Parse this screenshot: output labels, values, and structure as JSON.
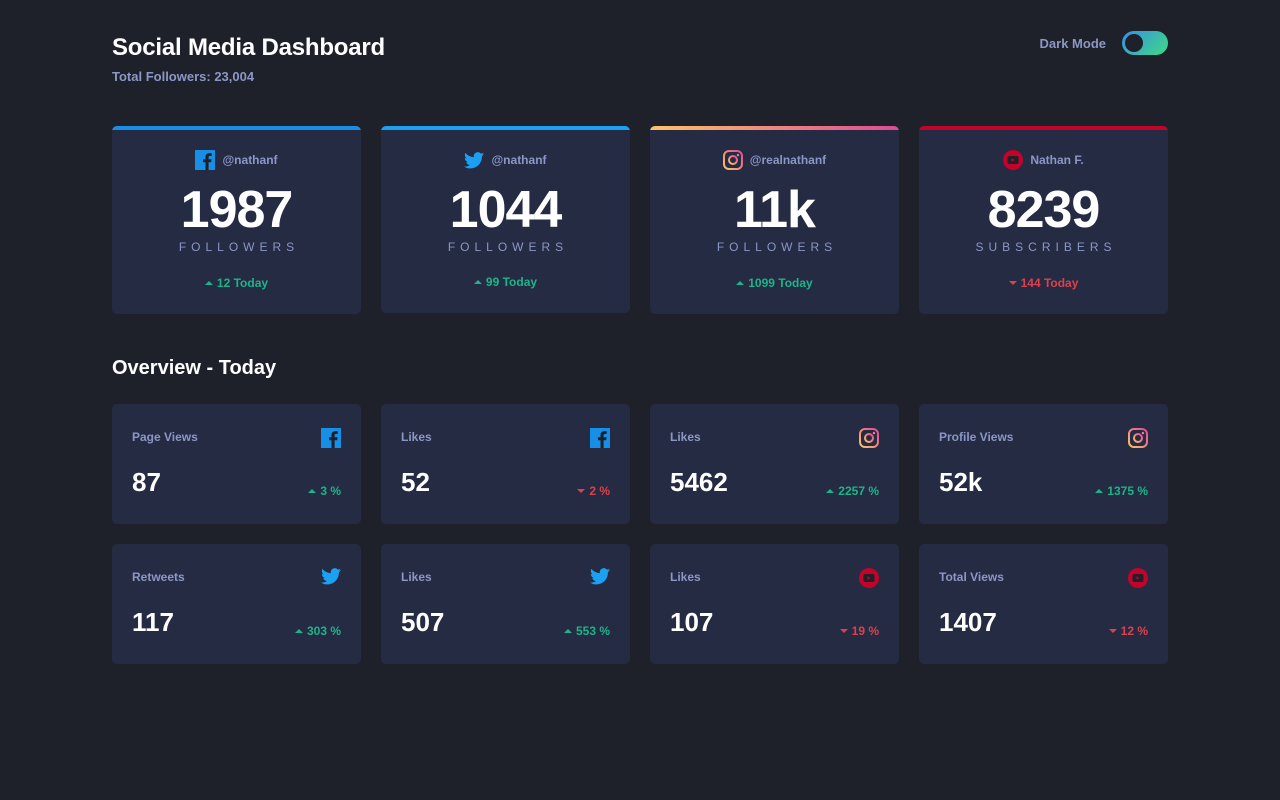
{
  "header": {
    "title": "Social Media Dashboard",
    "total_followers": "Total Followers: 23,004"
  },
  "toggle": {
    "label": "Dark Mode",
    "on": true
  },
  "colors": {
    "background": "#1e202a",
    "card": "#252b43",
    "muted_text": "#8b97c6",
    "up": "#1db489",
    "down": "#dc414c",
    "facebook": "#178fe6",
    "twitter": "#1ca0f2",
    "youtube": "#c4032a",
    "instagram_gradient": [
      "#fdc468",
      "#df4996"
    ]
  },
  "followers": [
    {
      "platform": "facebook",
      "icon": "facebook-icon",
      "handle": "@nathanf",
      "count": "1987",
      "unit": "FOLLOWERS",
      "change": "12 Today",
      "direction": "up"
    },
    {
      "platform": "twitter",
      "icon": "twitter-icon",
      "handle": "@nathanf",
      "count": "1044",
      "unit": "FOLLOWERS",
      "change": "99 Today",
      "direction": "up"
    },
    {
      "platform": "instagram",
      "icon": "instagram-icon",
      "handle": "@realnathanf",
      "count": "11k",
      "unit": "FOLLOWERS",
      "change": "1099 Today",
      "direction": "up"
    },
    {
      "platform": "youtube",
      "icon": "youtube-icon",
      "handle": "Nathan F.",
      "count": "8239",
      "unit": "SUBSCRIBERS",
      "change": "144 Today",
      "direction": "down"
    }
  ],
  "overview": {
    "title": "Overview - Today",
    "cards": [
      {
        "label": "Page Views",
        "platform": "facebook",
        "value": "87",
        "change": "3 %",
        "direction": "up"
      },
      {
        "label": "Likes",
        "platform": "facebook",
        "value": "52",
        "change": "2 %",
        "direction": "down"
      },
      {
        "label": "Likes",
        "platform": "instagram",
        "value": "5462",
        "change": "2257 %",
        "direction": "up"
      },
      {
        "label": "Profile Views",
        "platform": "instagram",
        "value": "52k",
        "change": "1375 %",
        "direction": "up"
      },
      {
        "label": "Retweets",
        "platform": "twitter",
        "value": "117",
        "change": "303 %",
        "direction": "up"
      },
      {
        "label": "Likes",
        "platform": "twitter",
        "value": "507",
        "change": "553 %",
        "direction": "up"
      },
      {
        "label": "Likes",
        "platform": "youtube",
        "value": "107",
        "change": "19 %",
        "direction": "down"
      },
      {
        "label": "Total Views",
        "platform": "youtube",
        "value": "1407",
        "change": "12 %",
        "direction": "down"
      }
    ]
  }
}
